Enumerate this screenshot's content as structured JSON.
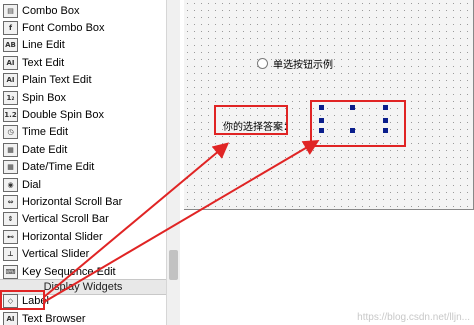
{
  "widget_box": {
    "items": [
      {
        "label": "Combo Box",
        "icon": "combo-box-icon",
        "glyph": "▤"
      },
      {
        "label": "Font Combo Box",
        "icon": "font-combo-box-icon",
        "glyph": "f"
      },
      {
        "label": "Line Edit",
        "icon": "line-edit-icon",
        "glyph": "AB"
      },
      {
        "label": "Text Edit",
        "icon": "text-edit-icon",
        "glyph": "AI"
      },
      {
        "label": "Plain Text Edit",
        "icon": "plain-text-edit-icon",
        "glyph": "AI"
      },
      {
        "label": "Spin Box",
        "icon": "spin-box-icon",
        "glyph": "1₂"
      },
      {
        "label": "Double Spin Box",
        "icon": "double-spin-box-icon",
        "glyph": "1.2"
      },
      {
        "label": "Time Edit",
        "icon": "clock-icon",
        "glyph": "◷"
      },
      {
        "label": "Date Edit",
        "icon": "calendar-icon",
        "glyph": "▦"
      },
      {
        "label": "Date/Time Edit",
        "icon": "calendar-clock-icon",
        "glyph": "▦"
      },
      {
        "label": "Dial",
        "icon": "dial-icon",
        "glyph": "◉"
      },
      {
        "label": "Horizontal Scroll Bar",
        "icon": "horizontal-scrollbar-icon",
        "glyph": "⇔"
      },
      {
        "label": "Vertical Scroll Bar",
        "icon": "vertical-scrollbar-icon",
        "glyph": "⇕"
      },
      {
        "label": "Horizontal Slider",
        "icon": "horizontal-slider-icon",
        "glyph": "⊷"
      },
      {
        "label": "Vertical Slider",
        "icon": "vertical-slider-icon",
        "glyph": "⊥"
      },
      {
        "label": "Key Sequence Edit",
        "icon": "key-sequence-icon",
        "glyph": "⌨"
      }
    ],
    "category": "Display Widgets",
    "display_items": [
      {
        "label": "Label",
        "icon": "label-icon",
        "glyph": "◇"
      },
      {
        "label": "Text Browser",
        "icon": "text-browser-icon",
        "glyph": "AI"
      }
    ]
  },
  "form": {
    "radio_label": "单选按钮示例",
    "answer_label": "你的选择答案："
  },
  "watermark": "https://blog.csdn.net/lljn..."
}
